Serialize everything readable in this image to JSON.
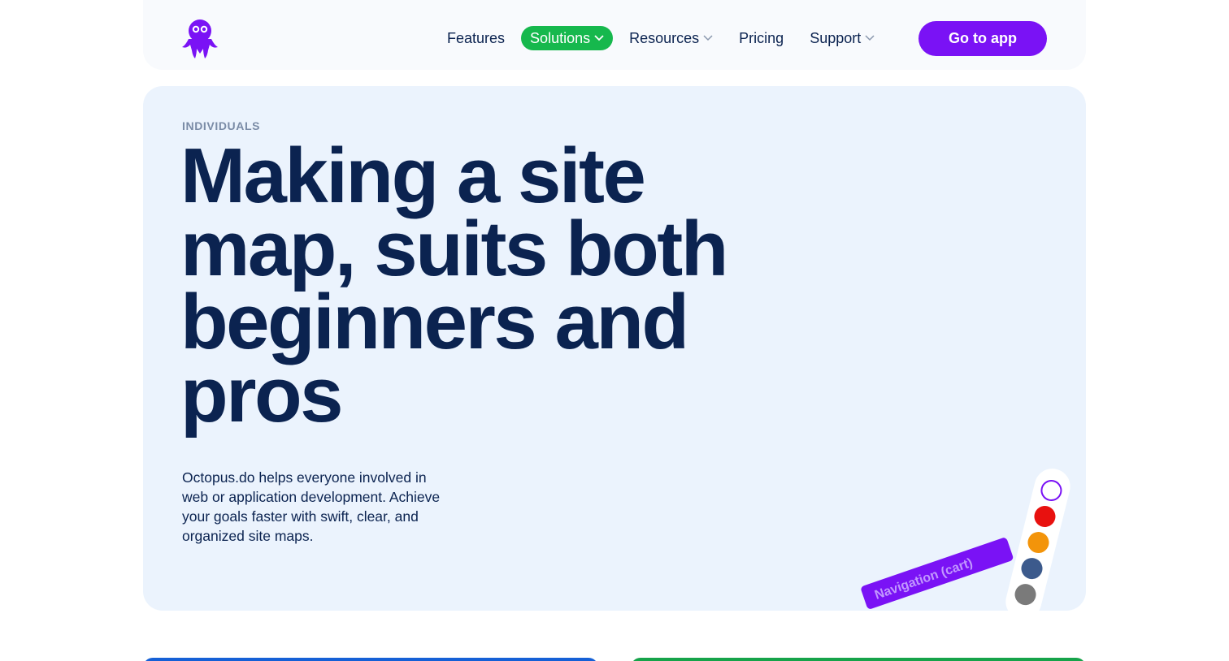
{
  "header": {
    "logo_icon": "octopus-logo-icon",
    "nav": [
      {
        "label": "Features",
        "has_dropdown": false,
        "active": false
      },
      {
        "label": "Solutions",
        "has_dropdown": true,
        "active": true
      },
      {
        "label": "Resources",
        "has_dropdown": true,
        "active": false
      },
      {
        "label": "Pricing",
        "has_dropdown": false,
        "active": false
      },
      {
        "label": "Support",
        "has_dropdown": true,
        "active": false
      }
    ],
    "cta_label": "Go to app"
  },
  "hero": {
    "eyebrow": "INDIVIDUALS",
    "headline": "Making a site map, suits both beginners and pros",
    "description": "Octopus.do helps everyone involved in web or application development. Achieve your goals faster with swift, clear, and organized site maps.",
    "decoration": {
      "tag_label": "Navigation (cart)",
      "swatch_colors": [
        "#ffffff",
        "#e8110f",
        "#f3940a",
        "#3c5a8c",
        "#7a7a7a"
      ]
    }
  },
  "colors": {
    "accent": "#7a12f5",
    "active_nav": "#16b84d",
    "text": "#0b2350",
    "hero_bg": "#ebf3fd"
  }
}
